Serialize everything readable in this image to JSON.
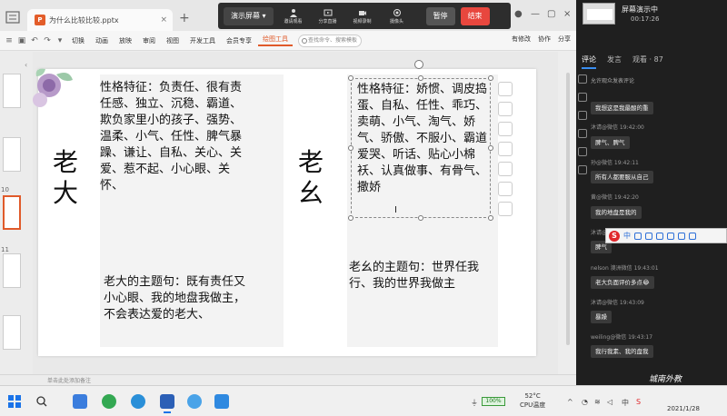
{
  "document_tab": {
    "name": "为什么比较比较.pptx"
  },
  "meeting_bar": {
    "present_label": "演示屏幕",
    "tools": [
      "邀请观看",
      "分享直播",
      "视频录制",
      "摄像头"
    ],
    "pause_label": "暂停",
    "end_label": "结束"
  },
  "ribbon": {
    "tabs": [
      "切换",
      "动画",
      "放映",
      "审阅",
      "视图",
      "开发工具",
      "会员专享",
      "绘图工具"
    ],
    "active_tab": "绘图工具",
    "search_placeholder": "查找命令、搜索模板",
    "right_actions": [
      "有修改",
      "协作",
      "分享"
    ]
  },
  "thumbs": {
    "labels": [
      "10",
      "11"
    ]
  },
  "slide": {
    "left": {
      "title": "老大",
      "traits": "性格特征：负责任、很有责任感、独立、沉稳、霸道、欺负家里小的孩子、强势、温柔、小气、任性、脾气暴躁、谦让、自私、关心、关爱、惹不起、小心眼、关怀、",
      "theme": "老大的主题句：既有责任又小心眼、我的地盘我做主，不会表达爱的老大、"
    },
    "right": {
      "title": "老幺",
      "traits": "性格特征：娇惯、调皮捣蛋、自私、任性、乖巧、卖萌、小气、淘气、娇气、骄傲、不服小、霸道爱哭、听话、贴心小棉袄、认真做事、有骨气、撒娇",
      "theme": "老幺的主题句：世界任我行、我的世界我做主"
    }
  },
  "status": {
    "text": "单击此处添加备注"
  },
  "live": {
    "title": "屏幕演示中",
    "elapsed": "00:17:26",
    "tabs": [
      "评论",
      "发言",
      "观看 · 87"
    ],
    "filter": "允许观众发表评论",
    "comments": [
      {
        "meta": "",
        "text": "我想这是我最酸的重"
      },
      {
        "meta": "沐请@微信 19:42:00",
        "text": "脾气、脾气"
      },
      {
        "meta": "孙@微信 19:42:11",
        "text": "所有人都要服从自己"
      },
      {
        "meta": "黄@微信 19:42:20",
        "text": "我的地盘是我的"
      },
      {
        "meta": "沐请@微信",
        "text": "脾气"
      },
      {
        "meta": "nelson 澳洲微信 19:43:01",
        "text": "老大负面评价多点😂"
      },
      {
        "meta": "沐请@微信 19:43:09",
        "text": "暴躁"
      },
      {
        "meta": "weiling@微信 19:43:17",
        "text": "我行我素、我的盘我"
      }
    ]
  },
  "ime": {
    "mode_label": "中"
  },
  "watermark": "城南外教",
  "taskbar": {
    "battery": "100%",
    "temperature": "52°C",
    "temp_label": "CPU温度",
    "lang": "中",
    "date": "2021/1/28"
  },
  "colors": {
    "accent": "#e05a2a",
    "end_button": "#e8473e",
    "panel": "#1f1f1f"
  }
}
